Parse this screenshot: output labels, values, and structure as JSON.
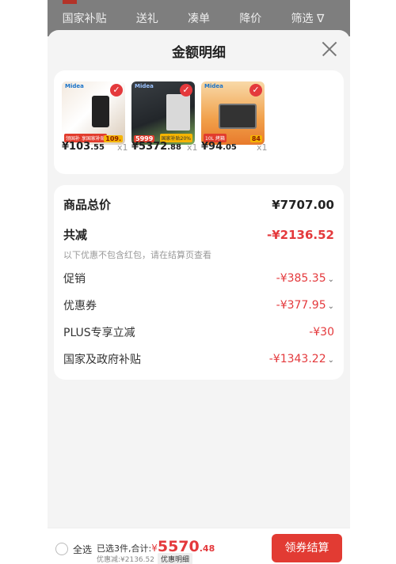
{
  "filters": [
    "国家补贴",
    "送礼",
    "凑单",
    "降价",
    "筛选 ∇"
  ],
  "sheet": {
    "title": "金额明细"
  },
  "products": [
    {
      "brand": "Midea",
      "badge": "109.",
      "tag": "领国补 享国家补贴",
      "price_int": "¥103",
      "price_dec": ".55",
      "qty": "x1",
      "colors": [
        "#f3e9de",
        "#d9c9b6"
      ]
    },
    {
      "brand": "Midea",
      "badge": "5999",
      "tag": "国家补贴20%",
      "price_int": "¥5372",
      "price_dec": ".88",
      "qty": "x1",
      "colors": [
        "#2b2f33",
        "#7fb05a"
      ]
    },
    {
      "brand": "Midea",
      "badge": "84",
      "tag": "10L 烤箱",
      "price_int": "¥94",
      "price_dec": ".05",
      "qty": "x1",
      "colors": [
        "#f1a04a",
        "#e87a2c"
      ]
    }
  ],
  "summary": {
    "total_label": "商品总价",
    "total_value": "¥7707.00",
    "discount_label": "共减",
    "discount_value": "-¥2136.52",
    "note": "以下优惠不包含红包，请在结算页查看",
    "items": [
      {
        "label": "促销",
        "value": "-¥385.35"
      },
      {
        "label": "优惠券",
        "value": "-¥377.95"
      },
      {
        "label": "PLUS专享立减",
        "value": "-¥30"
      },
      {
        "label": "国家及政府补贴",
        "value": "-¥1343.22"
      }
    ]
  },
  "bottom": {
    "select_all": "全选",
    "selected_text": "已选3件,合计:",
    "currency": "¥",
    "amount_int": "5570",
    "amount_dec": ".48",
    "discount_text": "优惠减:¥2136.52",
    "detail_label": "优惠明细",
    "checkout_label": "领券结算"
  },
  "colors": {
    "accent_red": "#e4393c",
    "button_red": "#e23b33"
  }
}
